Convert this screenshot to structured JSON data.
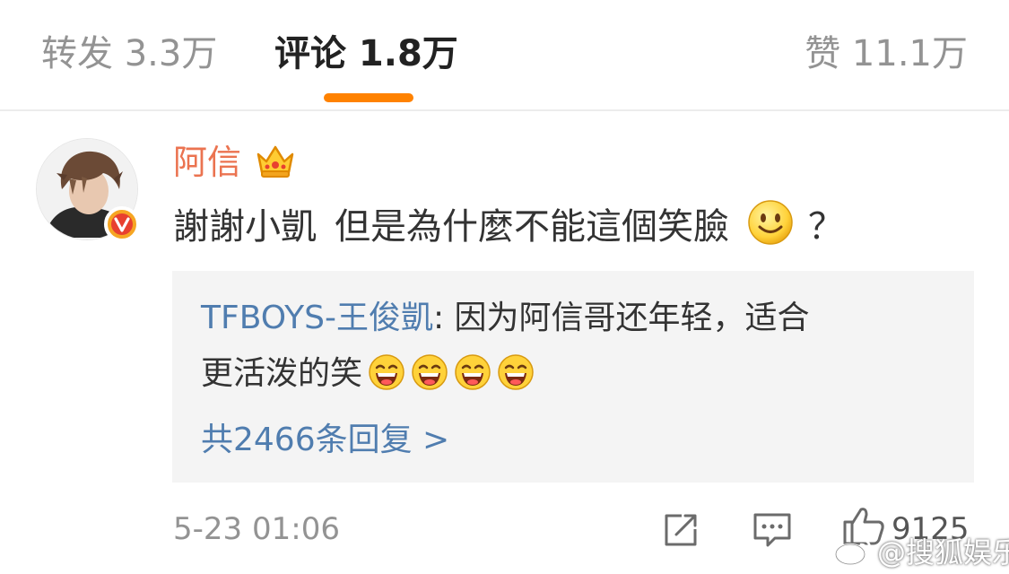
{
  "tabs": {
    "repost_label": "转发 3.3万",
    "comments_label": "评论 1.8万",
    "likes_label": "赞 11.1万",
    "active": "comments",
    "accent_color": "#ff8200"
  },
  "comment": {
    "username": "阿信",
    "username_color": "#eb7350",
    "badge_icon": "crown-icon",
    "verified_icon": "verified-v-icon",
    "text_part1": "謝謝小凱",
    "text_part2": "但是為什麼不能這個笑臉",
    "emoji": "smile-emoji",
    "text_end": "？",
    "timestamp": "5-23 01:06",
    "like_count": "9125"
  },
  "reply": {
    "author": "TFBOYS-王俊凱",
    "colon": ": ",
    "text_line1": "因为阿信哥还年轻，适合",
    "text_line2": "更活泼的笑",
    "emojis": [
      "laugh-emoji",
      "laugh-emoji",
      "laugh-emoji",
      "laugh-emoji"
    ],
    "total_replies": "共2466条回复 >",
    "link_color": "#507daf"
  },
  "actions": {
    "share_icon": "share-icon",
    "comment_icon": "comment-icon",
    "like_icon": "thumbs-up-icon"
  },
  "watermark": {
    "text": "@搜狐娱乐"
  }
}
